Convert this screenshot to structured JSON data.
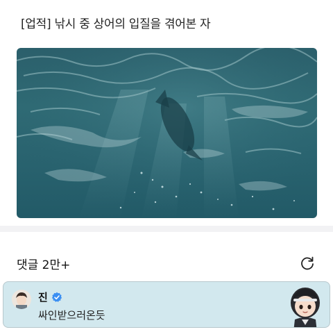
{
  "post": {
    "title": "[업적] 낚시 중 상어의 입질을 겪어본 자"
  },
  "video": {
    "description_icon": "sea-video-thumbnail"
  },
  "comments": {
    "count_label": "댓글 2만+",
    "refresh_icon": "refresh-icon",
    "items": [
      {
        "author": "진",
        "verified": true,
        "text": "싸인받으러온듯",
        "card_color": "#d2e8ee",
        "badge_color": "#3b8ff2"
      }
    ]
  }
}
